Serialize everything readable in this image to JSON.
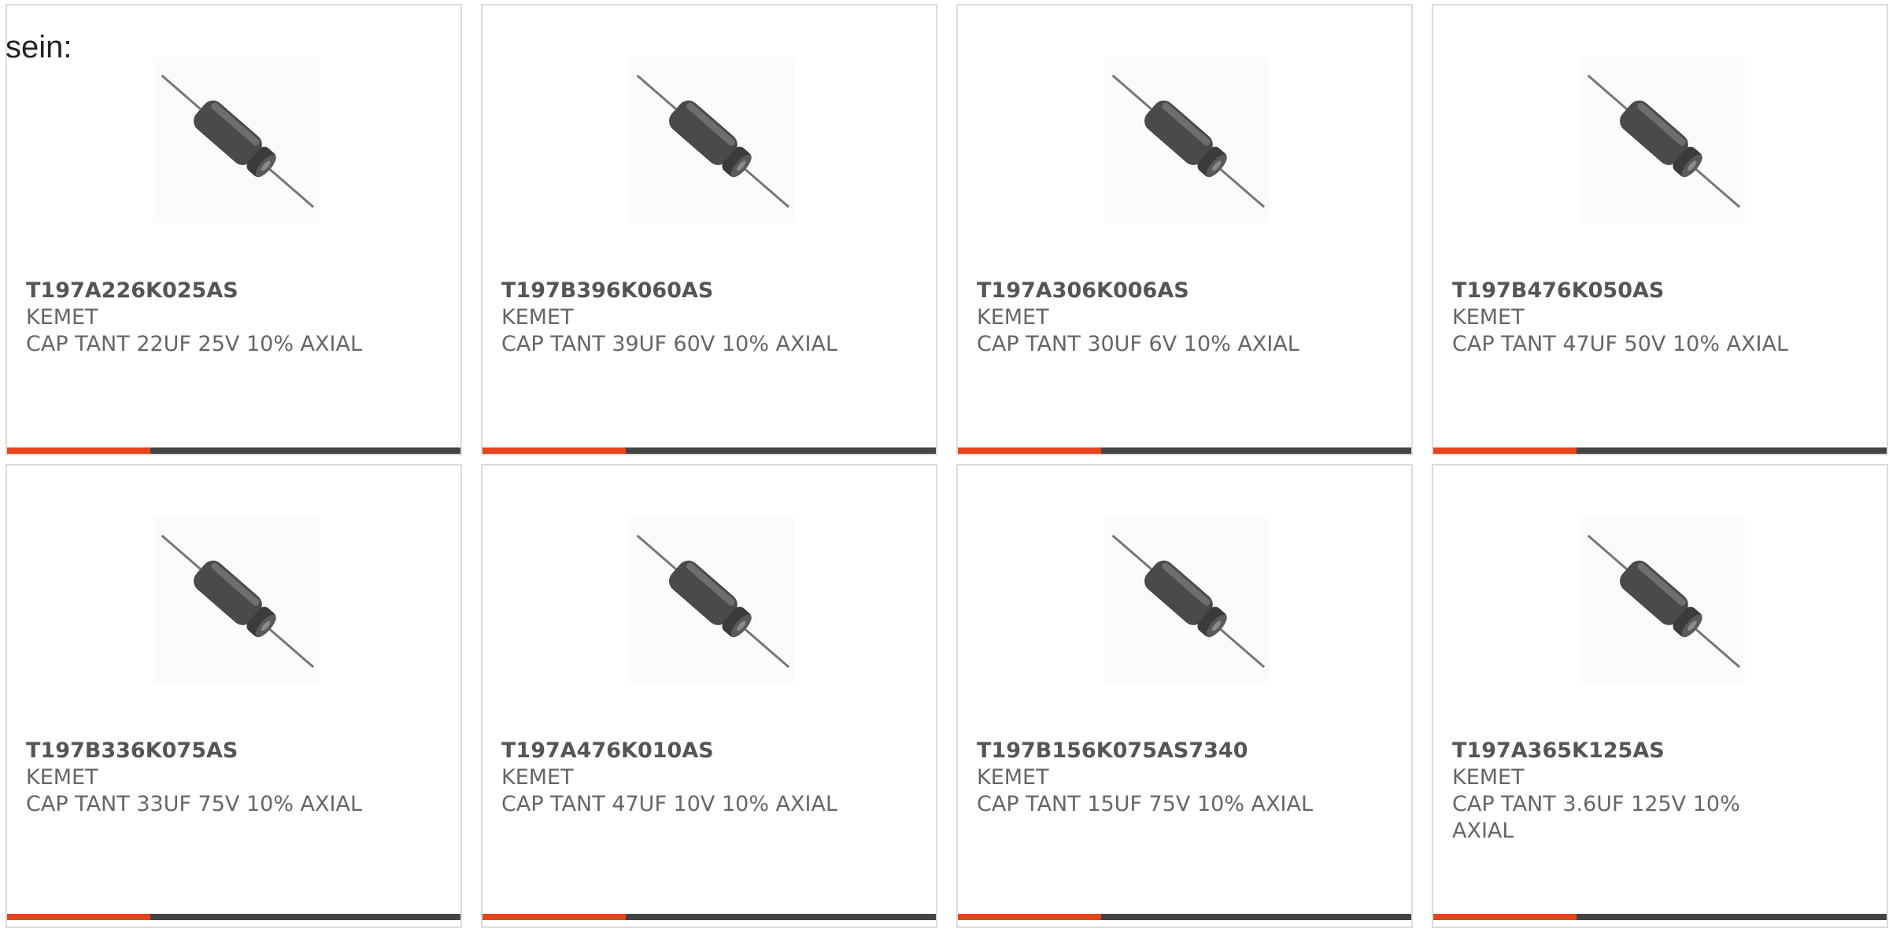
{
  "intro_text": "sein:",
  "colors": {
    "accent": "#e8431a",
    "bar": "#444444",
    "border": "#dcdcdc",
    "text": "#555555"
  },
  "products": [
    {
      "part_number": "T197A226K025AS",
      "manufacturer": "KEMET",
      "description": "CAP TANT 22UF 25V 10% AXIAL",
      "image_icon": "axial-tantalum-capacitor-image"
    },
    {
      "part_number": "T197B396K060AS",
      "manufacturer": "KEMET",
      "description": "CAP TANT 39UF 60V 10% AXIAL",
      "image_icon": "axial-tantalum-capacitor-image"
    },
    {
      "part_number": "T197A306K006AS",
      "manufacturer": "KEMET",
      "description": "CAP TANT 30UF 6V 10% AXIAL",
      "image_icon": "axial-tantalum-capacitor-image"
    },
    {
      "part_number": "T197B476K050AS",
      "manufacturer": "KEMET",
      "description": "CAP TANT 47UF 50V 10% AXIAL",
      "image_icon": "axial-tantalum-capacitor-image"
    },
    {
      "part_number": "T197B336K075AS",
      "manufacturer": "KEMET",
      "description": "CAP TANT 33UF 75V 10% AXIAL",
      "image_icon": "axial-tantalum-capacitor-image"
    },
    {
      "part_number": "T197A476K010AS",
      "manufacturer": "KEMET",
      "description": "CAP TANT 47UF 10V 10% AXIAL",
      "image_icon": "axial-tantalum-capacitor-image"
    },
    {
      "part_number": "T197B156K075AS7340",
      "manufacturer": "KEMET",
      "description": "CAP TANT 15UF 75V 10% AXIAL",
      "image_icon": "axial-tantalum-capacitor-image"
    },
    {
      "part_number": "T197A365K125AS",
      "manufacturer": "KEMET",
      "description": "CAP TANT 3.6UF 125V 10% AXIAL",
      "image_icon": "axial-tantalum-capacitor-image"
    }
  ]
}
